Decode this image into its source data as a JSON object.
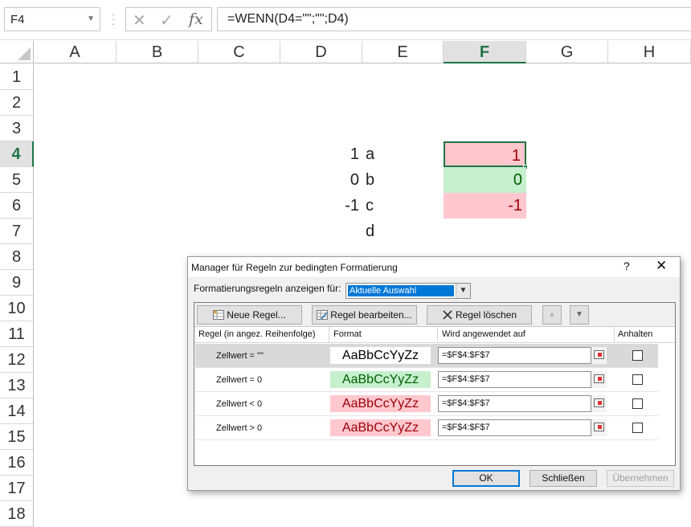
{
  "formula_bar": {
    "name_box": "F4",
    "cancel_icon": "close-icon",
    "enter_icon": "check-icon",
    "function_label": "fx",
    "formula": "=WENN(D4=\"\";\"\";D4)"
  },
  "sheet": {
    "columns": [
      "A",
      "B",
      "C",
      "D",
      "E",
      "F",
      "G",
      "H"
    ],
    "selected_column": "F",
    "rows": [
      "1",
      "2",
      "3",
      "4",
      "5",
      "6",
      "7",
      "8",
      "9",
      "10",
      "11",
      "12",
      "13",
      "14",
      "15",
      "16",
      "17",
      "18"
    ],
    "selected_row": "4",
    "cells": {
      "D4": "1",
      "E4": "a",
      "D5": "0",
      "E5": "b",
      "D6": "-1",
      "E6": "c",
      "E7": "d",
      "F4": "1",
      "F5": "0",
      "F6": "-1"
    },
    "colors": {
      "red_fill": "#ffc7ce",
      "red_text": "#9c0006",
      "green_fill": "#c6efce",
      "green_text": "#006100",
      "selection": "#217346"
    }
  },
  "dialog": {
    "title": "Manager für Regeln zur bedingten Formatierung",
    "help": "?",
    "close": "✕",
    "show_rules_label": "Formatierungsregeln anzeigen für:",
    "show_rules_value": "Aktuelle Auswahl",
    "buttons": {
      "new_rule": "Neue Regel...",
      "edit_rule": "Regel bearbeiten...",
      "delete_rule": "Regel löschen",
      "move_up": "▲",
      "move_down": "▼"
    },
    "columns": {
      "rule": "Regel (in angez. Reihenfolge)",
      "format": "Format",
      "applies_to": "Wird angewendet auf",
      "stop": "Anhalten"
    },
    "rules": [
      {
        "name": "Zellwert = \"\"",
        "preview": "AaBbCcYyZz",
        "applies_to": "=$F$4:$F$7",
        "fill": "#ffffff",
        "color": "#000000",
        "selected": true
      },
      {
        "name": "Zellwert = 0",
        "preview": "AaBbCcYyZz",
        "applies_to": "=$F$4:$F$7",
        "fill": "#c6efce",
        "color": "#006100",
        "selected": false
      },
      {
        "name": "Zellwert < 0",
        "preview": "AaBbCcYyZz",
        "applies_to": "=$F$4:$F$7",
        "fill": "#ffc7ce",
        "color": "#9c0006",
        "selected": false
      },
      {
        "name": "Zellwert > 0",
        "preview": "AaBbCcYyZz",
        "applies_to": "=$F$4:$F$7",
        "fill": "#ffc7ce",
        "color": "#9c0006",
        "selected": false
      }
    ],
    "footer": {
      "ok": "OK",
      "close": "Schließen",
      "apply": "Übernehmen"
    }
  }
}
